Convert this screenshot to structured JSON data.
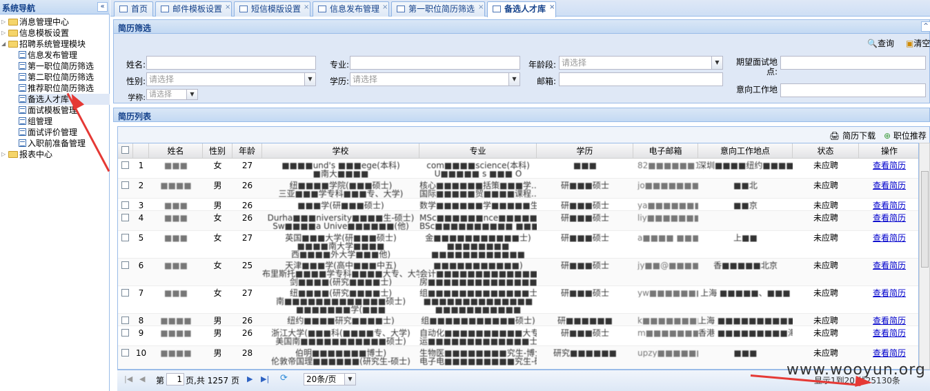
{
  "nav": {
    "title": "系统导航",
    "collapse": "«",
    "items": [
      {
        "label": "消息管理中心",
        "type": "folder",
        "expanded": false
      },
      {
        "label": "信息模板设置",
        "type": "folder",
        "expanded": false
      },
      {
        "label": "招聘系统管理模块",
        "type": "folder",
        "expanded": true
      },
      {
        "label": "信息发布管理",
        "type": "leaf"
      },
      {
        "label": "第一职位简历筛选",
        "type": "leaf"
      },
      {
        "label": "第二职位简历筛选",
        "type": "leaf"
      },
      {
        "label": "推荐职位简历筛选",
        "type": "leaf"
      },
      {
        "label": "备选人才库",
        "type": "leaf",
        "selected": true
      },
      {
        "label": "面试模板管理",
        "type": "leaf"
      },
      {
        "label": "组管理",
        "type": "leaf"
      },
      {
        "label": "面试评价管理",
        "type": "leaf"
      },
      {
        "label": "入职前准备管理",
        "type": "leaf"
      },
      {
        "label": "报表中心",
        "type": "folder",
        "expanded": false
      }
    ]
  },
  "tabs": [
    {
      "label": "首页"
    },
    {
      "label": "邮件模板设置"
    },
    {
      "label": "短信模版设置"
    },
    {
      "label": "信息发布管理"
    },
    {
      "label": "第一职位简历筛选"
    },
    {
      "label": "备选人才库",
      "active": true
    }
  ],
  "search": {
    "title": "简历筛选",
    "query_btn": "查询",
    "clear_btn": "清空",
    "name_label": "姓名:",
    "major_label": "专业:",
    "age_label": "年龄段:",
    "age_placeholder": "请选择",
    "expect_label": "期望面试地点:",
    "gender_label": "性别:",
    "gender_placeholder": "请选择",
    "edu_label": "学历:",
    "edu_placeholder": "请选择",
    "email_label": "邮箱:",
    "work_label": "意向工作地点:",
    "degree_label": "学称:",
    "degree_placeholder": "请选择"
  },
  "list": {
    "title": "简历列表",
    "download_btn": "简历下载",
    "recommend_btn": "职位推荐",
    "columns": [
      "姓名",
      "性别",
      "年龄",
      "学校",
      "专业",
      "学历",
      "电子邮箱",
      "意向工作地点",
      "状态",
      "操作"
    ],
    "rows": [
      {
        "num": "1",
        "name": "■■■",
        "gender": "女",
        "age": "27",
        "school": [
          "■■■■und's ■■■ege(本科)",
          "■南大■■■■"
        ],
        "major": [
          "com■■■■science(本科)",
          "U■■■■■ s ■■■ O"
        ],
        "edu": [
          "■■■"
        ],
        "email": "82■■■■■■14...",
        "place": [
          "深圳■■■■纽约■■■■斯顿..."
        ],
        "status": "未应聘",
        "action": "查看简历"
      },
      {
        "num": "2",
        "name": "■■■■",
        "gender": "男",
        "age": "26",
        "school": [
          "纽■■■■学院(■■■硕士)",
          "三亚■■■学专科■■■专、大学)"
        ],
        "major": [
          "核心■■■■■■括策■■■学...",
          "国际■■■■■贸■■■■课程..."
        ],
        "edu": [
          "研■■■硕士"
        ],
        "email": "jo■■■■■■■■■■",
        "place": [
          "■■北"
        ],
        "status": "未应聘",
        "action": "查看简历"
      },
      {
        "num": "3",
        "name": "■■■",
        "gender": "男",
        "age": "26",
        "school": [
          "■■■学(研■■■硕士)"
        ],
        "major": [
          "数学■■■■■■学■■■■■生-..."
        ],
        "edu": [
          "研■■■硕士"
        ],
        "email": "ya■■■■■■■■■■",
        "place": [
          "■■京"
        ],
        "status": "未应聘",
        "action": "查看简历"
      },
      {
        "num": "4",
        "name": "■■■",
        "gender": "女",
        "age": "26",
        "school": [
          "Durha■■■niversity■■■■生-硕士)",
          "Sw■■■■a Unive■■■■■■(他)"
        ],
        "major": [
          "MSc■■■■■■nce■■■■■■■...",
          "BSc■■■■■■■■■■ ■■■■..."
        ],
        "edu": [
          "研■■■硕士"
        ],
        "email": "liy■■■■■■■■■■",
        "place": [
          ""
        ],
        "status": "未应聘",
        "action": "查看简历"
      },
      {
        "num": "5",
        "name": "■■■",
        "gender": "女",
        "age": "27",
        "school": [
          "英国■■■大学(研■■■硕士)",
          "■■■■南大学■■■■",
          "西■■■■外大学■■■他)"
        ],
        "major": [
          "金■■■■■■■■■■■士)",
          "■■■■■■■■",
          "■■■■■■■■■■■■"
        ],
        "edu": [
          "研■■■硕士"
        ],
        "email": "a■■■■ ■■■■ ■...",
        "place": [
          "上■■"
        ],
        "status": "未应聘",
        "action": "查看简历"
      },
      {
        "num": "6",
        "name": "■■■",
        "gender": "女",
        "age": "25",
        "school": [
          "天津■■■学(高中■■■中五)",
          "布里斯托■■■■学专科■■■■大专、大学)",
          "剑■■■■(研究■■■■士)"
        ],
        "major": [
          "■■■■■■■■■■■)",
          "会计■■■■■■■■■■■■■港...",
          "房■■■■■■■■■■■■■■■)"
        ],
        "edu": [
          "研■■■硕士"
        ],
        "email": "jy■■@■■■■ ...",
        "place": [
          "香■■■■■北京"
        ],
        "status": "未应聘",
        "action": "查看简历"
      },
      {
        "num": "7",
        "name": "■■■",
        "gender": "女",
        "age": "27",
        "school": [
          "纽■■■■(研究■■■■士)",
          "南■■■■■■■■■■■■■硕士)",
          "■■■■■■■学(■■■"
        ],
        "major": [
          "组■■■■■■■■■■■■■士)",
          "■■■■■■■■■■■■■■",
          "■■■■■■■■■■■"
        ],
        "edu": [
          "研■■■硕士"
        ],
        "email": "yw■■■■■■■■■■",
        "place": [
          "上海 ■■■■■、■■■"
        ],
        "status": "未应聘",
        "action": "查看简历"
      },
      {
        "num": "8",
        "name": "■■■■",
        "gender": "男",
        "age": "26",
        "school": [
          "纽约■■■■研究■■■■士)"
        ],
        "major": [
          "组■■■■■■■■■■■硕士)"
        ],
        "edu": [
          "研■■■■■■"
        ],
        "email": "k■■■■■■■■■■",
        "place": [
          "上海 ■■■■■■■■■■■■"
        ],
        "status": "未应聘",
        "action": "查看简历"
      },
      {
        "num": "9",
        "name": "■■■■",
        "gender": "男",
        "age": "26",
        "school": [
          "浙江大学(■■■科(■■■■专、大学)",
          "美国南■■■■■■■■■■■硕士)"
        ],
        "major": [
          "自动化■■■■■■■■■■大专...",
          "运■■■■■■■■■■■■■士)"
        ],
        "edu": [
          "研■■■硕士"
        ],
        "email": "m■■■■■■■■■■■",
        "place": [
          "香港 ■■■■■■■■■海"
        ],
        "status": "未应聘",
        "action": "查看简历"
      },
      {
        "num": "10",
        "name": "■■■■",
        "gender": "男",
        "age": "28",
        "school": [
          "伯明■■■■■■■博士)",
          "伦敦帝国理■■■■■■(研究生-硕士)"
        ],
        "major": [
          "生物医■■■■■■■■究生-博士)",
          "电子电■■■■■■■■■究生-硕士)"
        ],
        "edu": [
          "研究■■■■■■"
        ],
        "email": "upzy■■■■■■@...",
        "place": [
          "■■■"
        ],
        "status": "未应聘",
        "action": "查看简历"
      }
    ]
  },
  "pager": {
    "page_label": "第",
    "page_value": "1",
    "total_pages": "页,共 1257 页",
    "page_size": "20条/页",
    "summary": "显示1到20,共25130条"
  },
  "watermark": "www.wooyun.org"
}
